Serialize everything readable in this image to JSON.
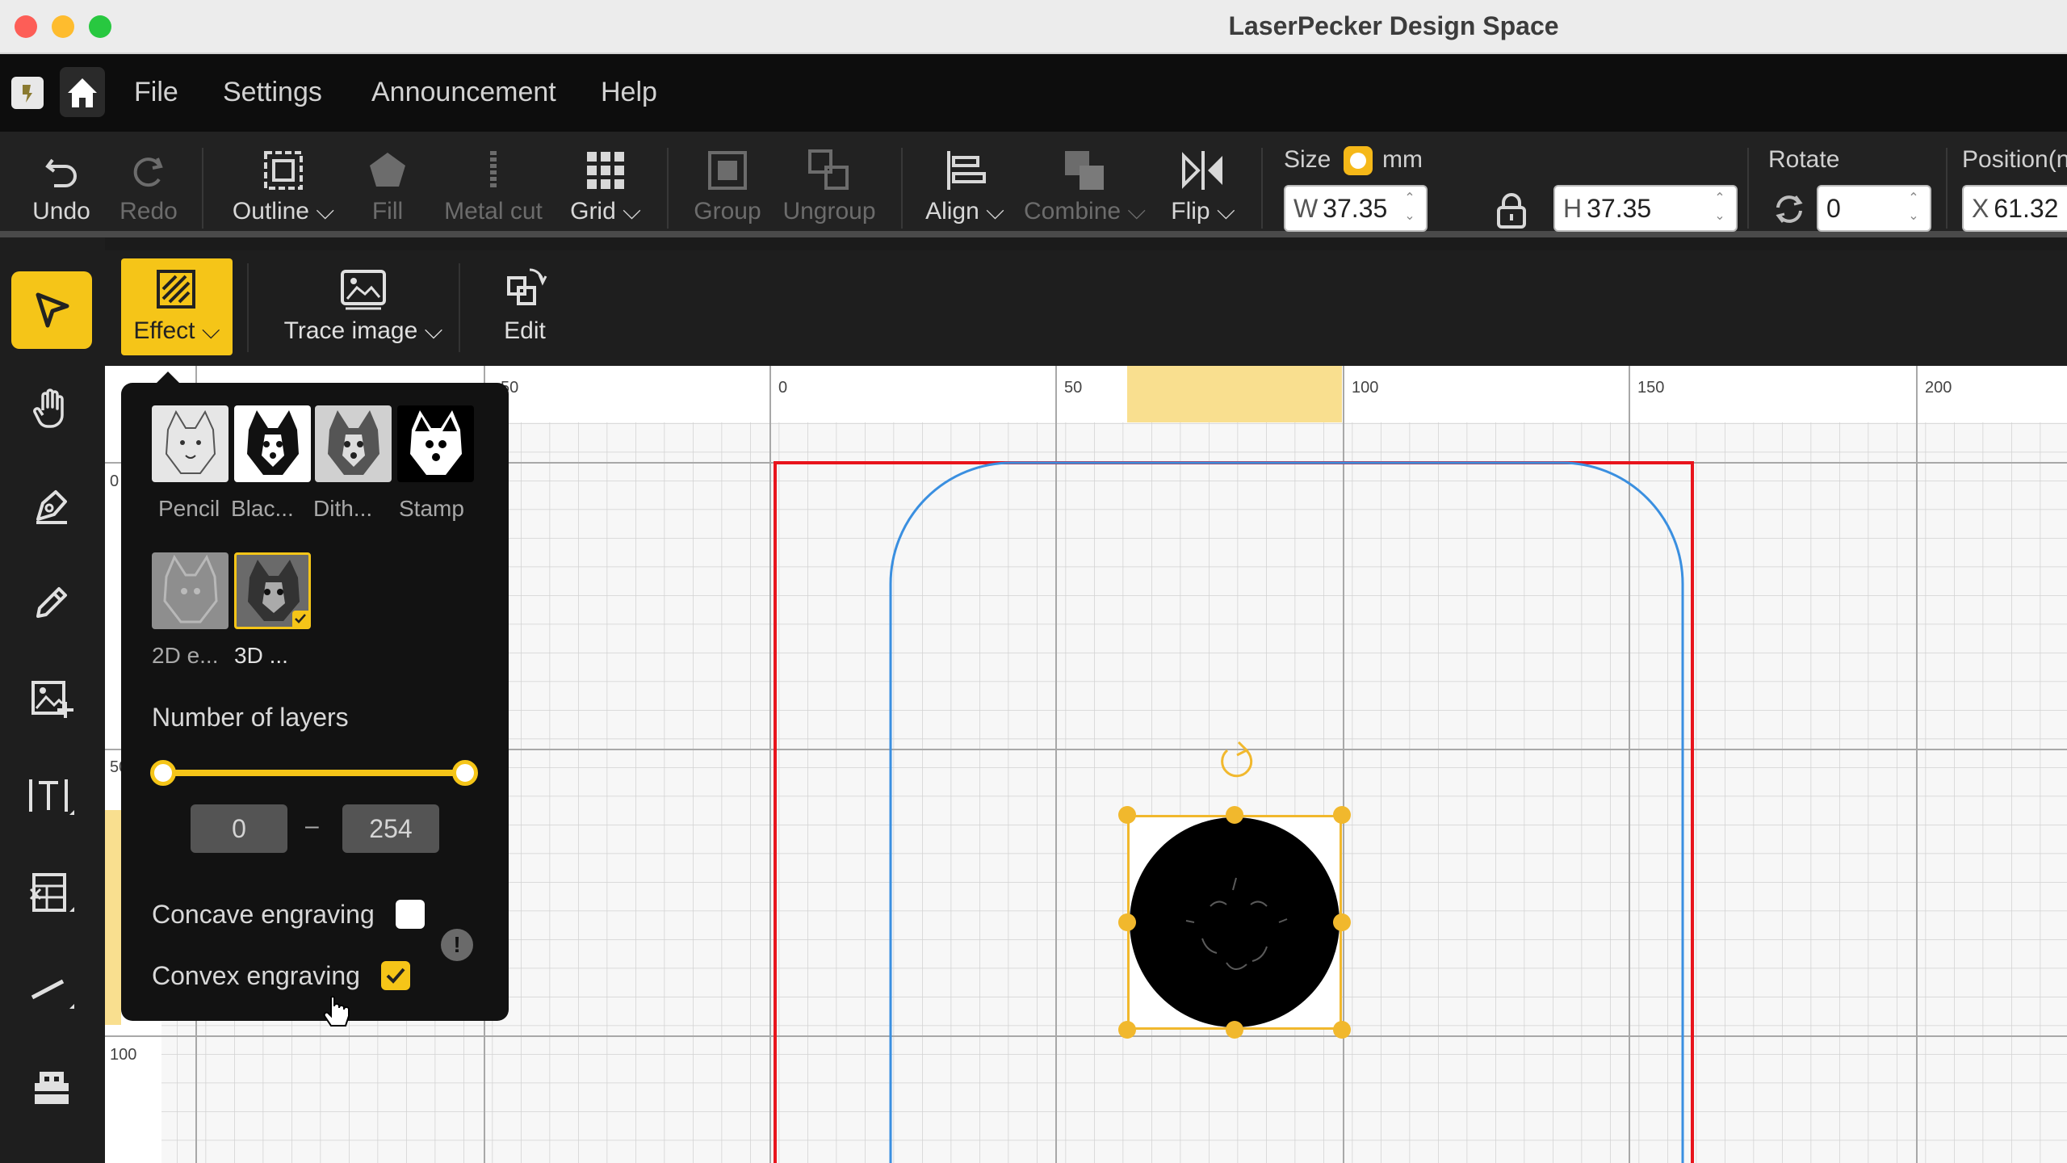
{
  "window": {
    "title": "LaserPecker Design Space"
  },
  "menu": {
    "items": [
      "File",
      "Settings",
      "Announcement",
      "Help"
    ]
  },
  "toolbar": {
    "undo": "Undo",
    "redo": "Redo",
    "outline": "Outline",
    "fill": "Fill",
    "metal_cut": "Metal cut",
    "grid": "Grid",
    "group": "Group",
    "ungroup": "Ungroup",
    "align": "Align",
    "combine": "Combine",
    "flip": "Flip",
    "size_label": "Size",
    "unit": "mm",
    "width_prefix": "W",
    "width_value": "37.35",
    "height_prefix": "H",
    "height_value": "37.35",
    "rotate_label": "Rotate",
    "rotate_value": "0",
    "position_label": "Position(n",
    "x_prefix": "X",
    "x_value": "61.32"
  },
  "secondary_toolbar": {
    "effect": "Effect",
    "trace_image": "Trace image",
    "edit": "Edit"
  },
  "effect_panel": {
    "effects": [
      "Pencil",
      "Blac...",
      "Dith...",
      "Stamp"
    ],
    "effects_row2": [
      "2D e...",
      "3D ..."
    ],
    "selected_effect": "3D ...",
    "layers_title": "Number of layers",
    "layers_min": "0",
    "layers_dash": "–",
    "layers_max": "254",
    "concave_label": "Concave engraving",
    "concave_checked": false,
    "convex_label": "Convex engraving",
    "convex_checked": true
  },
  "ruler": {
    "top_ticks": [
      "50",
      "0",
      "50",
      "100",
      "150",
      "200"
    ],
    "left_ticks": [
      "0",
      "50",
      "100"
    ]
  },
  "colors": {
    "accent": "#f5c518",
    "workspace_border": "#e8141c",
    "path_line": "#3a8fe0",
    "selection": "#f1b82d"
  }
}
